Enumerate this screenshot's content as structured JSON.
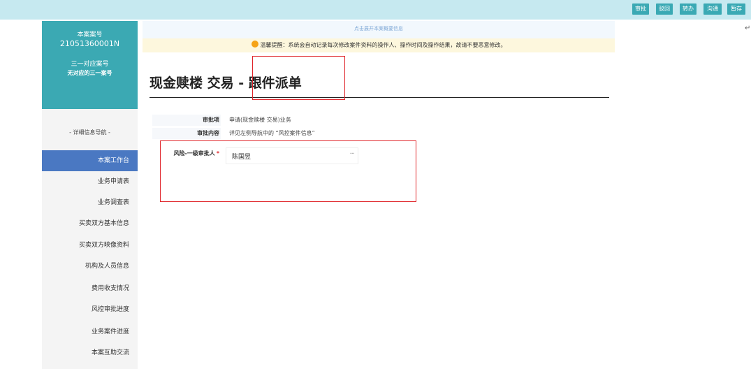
{
  "toolbar": {
    "buttons": [
      {
        "label": "审批"
      },
      {
        "label": "驳回"
      },
      {
        "label": "转办"
      },
      {
        "label": "沟通"
      },
      {
        "label": "暂存"
      }
    ]
  },
  "return_mark": "↵",
  "case": {
    "case_label": "本案案号",
    "case_number": "21051360001N",
    "unique_label": "三一对应案号",
    "unique_value": "无对应的三一案号"
  },
  "nav": {
    "title": "- 详细信息导航 -",
    "items": [
      {
        "label": "本案工作台"
      },
      {
        "label": "业务申请表"
      },
      {
        "label": "业务调查表"
      },
      {
        "label": "买卖双方基本信息"
      },
      {
        "label": "买卖双方映像资料"
      },
      {
        "label": "机构及人员信息"
      },
      {
        "label": "费用收支情况"
      },
      {
        "label": "风控审批进度"
      },
      {
        "label": "业务案件进度"
      },
      {
        "label": "本案互助交流"
      }
    ]
  },
  "main": {
    "expand_text": "点击展开本案概要信息",
    "notice_text": "温馨提醒：系统会自动记录每次修改案件资料的操作人、操作时间及操作结果，故请不要恶意修改。",
    "page_title": "现金赎楼 交易 - 跟件派单",
    "info": [
      {
        "label": "审批项",
        "value": "申请(现金赎楼 交易)业务"
      },
      {
        "label": "审批内容",
        "value": "详见左侧导航中的 “风控案件信息”"
      }
    ],
    "approver": {
      "label": "风险-一级审批人",
      "required_mark": "*",
      "value": "陈国昱",
      "more": "···"
    }
  },
  "colors": {
    "topbar": "#c6e9f0",
    "button": "#3aa9b4",
    "case_box": "#3ba9b3",
    "nav_active": "#4a78c2",
    "highlight": "#e0262b"
  }
}
